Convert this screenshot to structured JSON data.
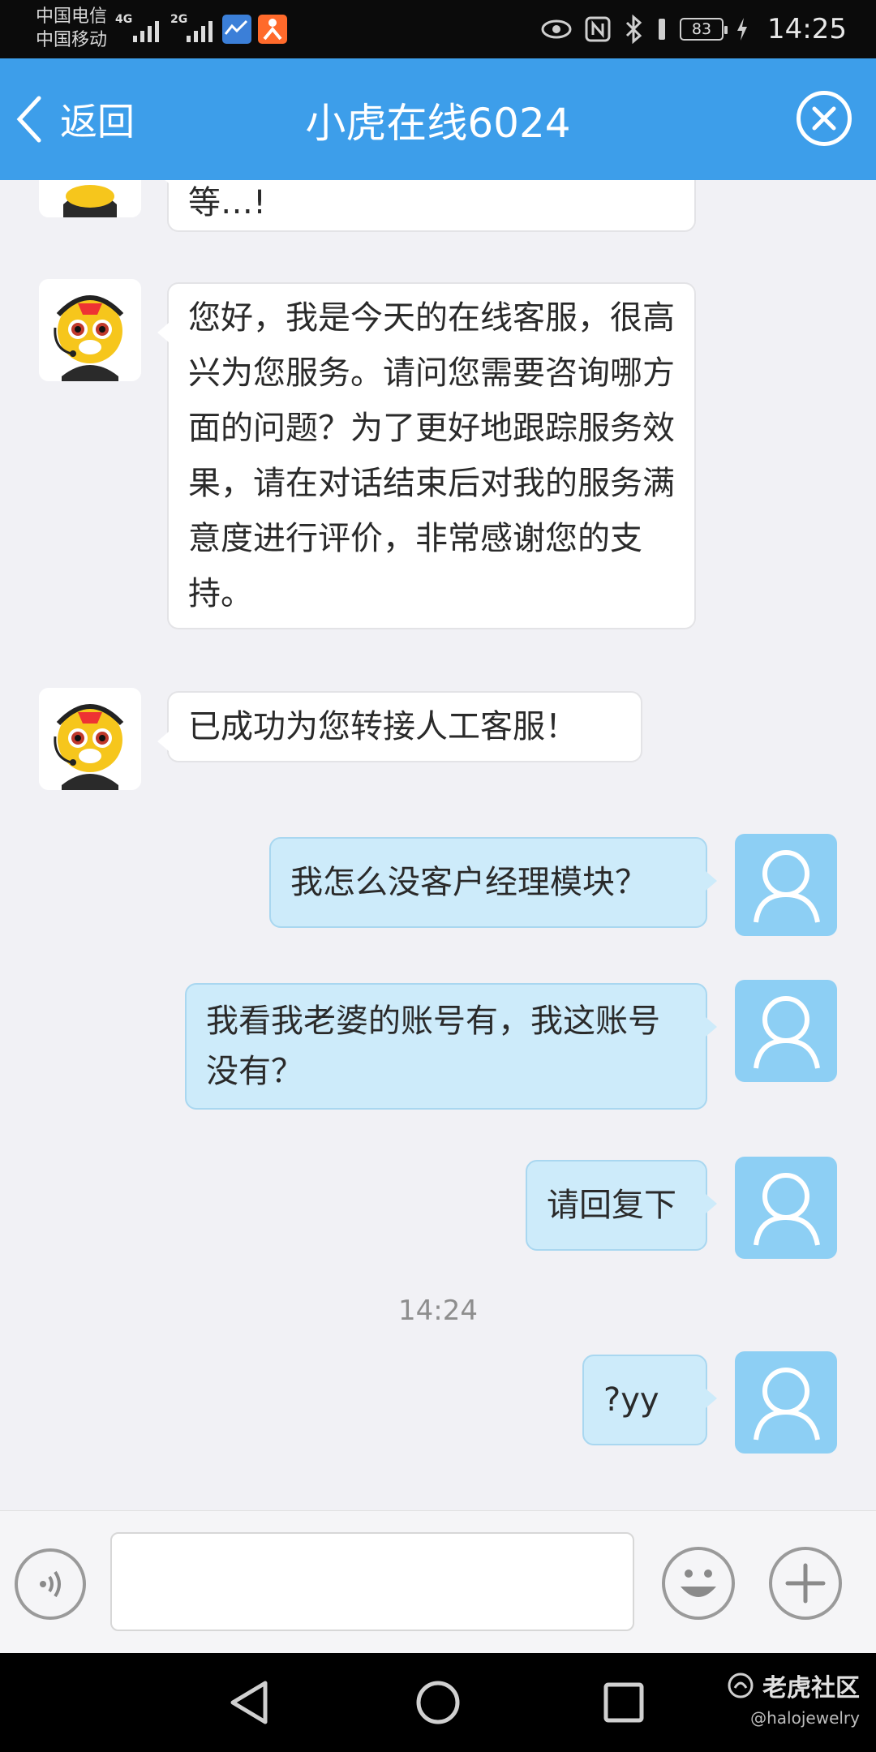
{
  "status_bar": {
    "carrier1": "中国电信",
    "carrier2": "中国移动",
    "net1": "4G",
    "net2": "2G",
    "battery": "83",
    "time": "14:25"
  },
  "header": {
    "back_label": "返回",
    "title": "小虎在线6024",
    "background_color": "#3d9eea"
  },
  "chat": {
    "partial_message": "等…!",
    "messages": [
      {
        "from": "agent",
        "text": "您好，我是今天的在线客服，很高兴为您服务。请问您需要咨询哪方面的问题？为了更好地跟踪服务效果，请在对话结束后对我的服务满意度进行评价，非常感谢您的支持。"
      },
      {
        "from": "agent",
        "text": "已成功为您转接人工客服！"
      },
      {
        "from": "user",
        "text": "我怎么没客户经理模块？"
      },
      {
        "from": "user",
        "text": "我看我老婆的账号有，我这账号没有？"
      },
      {
        "from": "user",
        "text": "请回复下"
      },
      {
        "from": "user",
        "text": "?yy"
      }
    ],
    "timestamp": "14:24"
  },
  "input_bar": {
    "placeholder": "",
    "voice_icon": "voice-icon",
    "emoji_icon": "emoji-icon",
    "plus_icon": "plus-icon"
  },
  "watermark": {
    "title": "老虎社区",
    "handle": "@halojewelry"
  }
}
